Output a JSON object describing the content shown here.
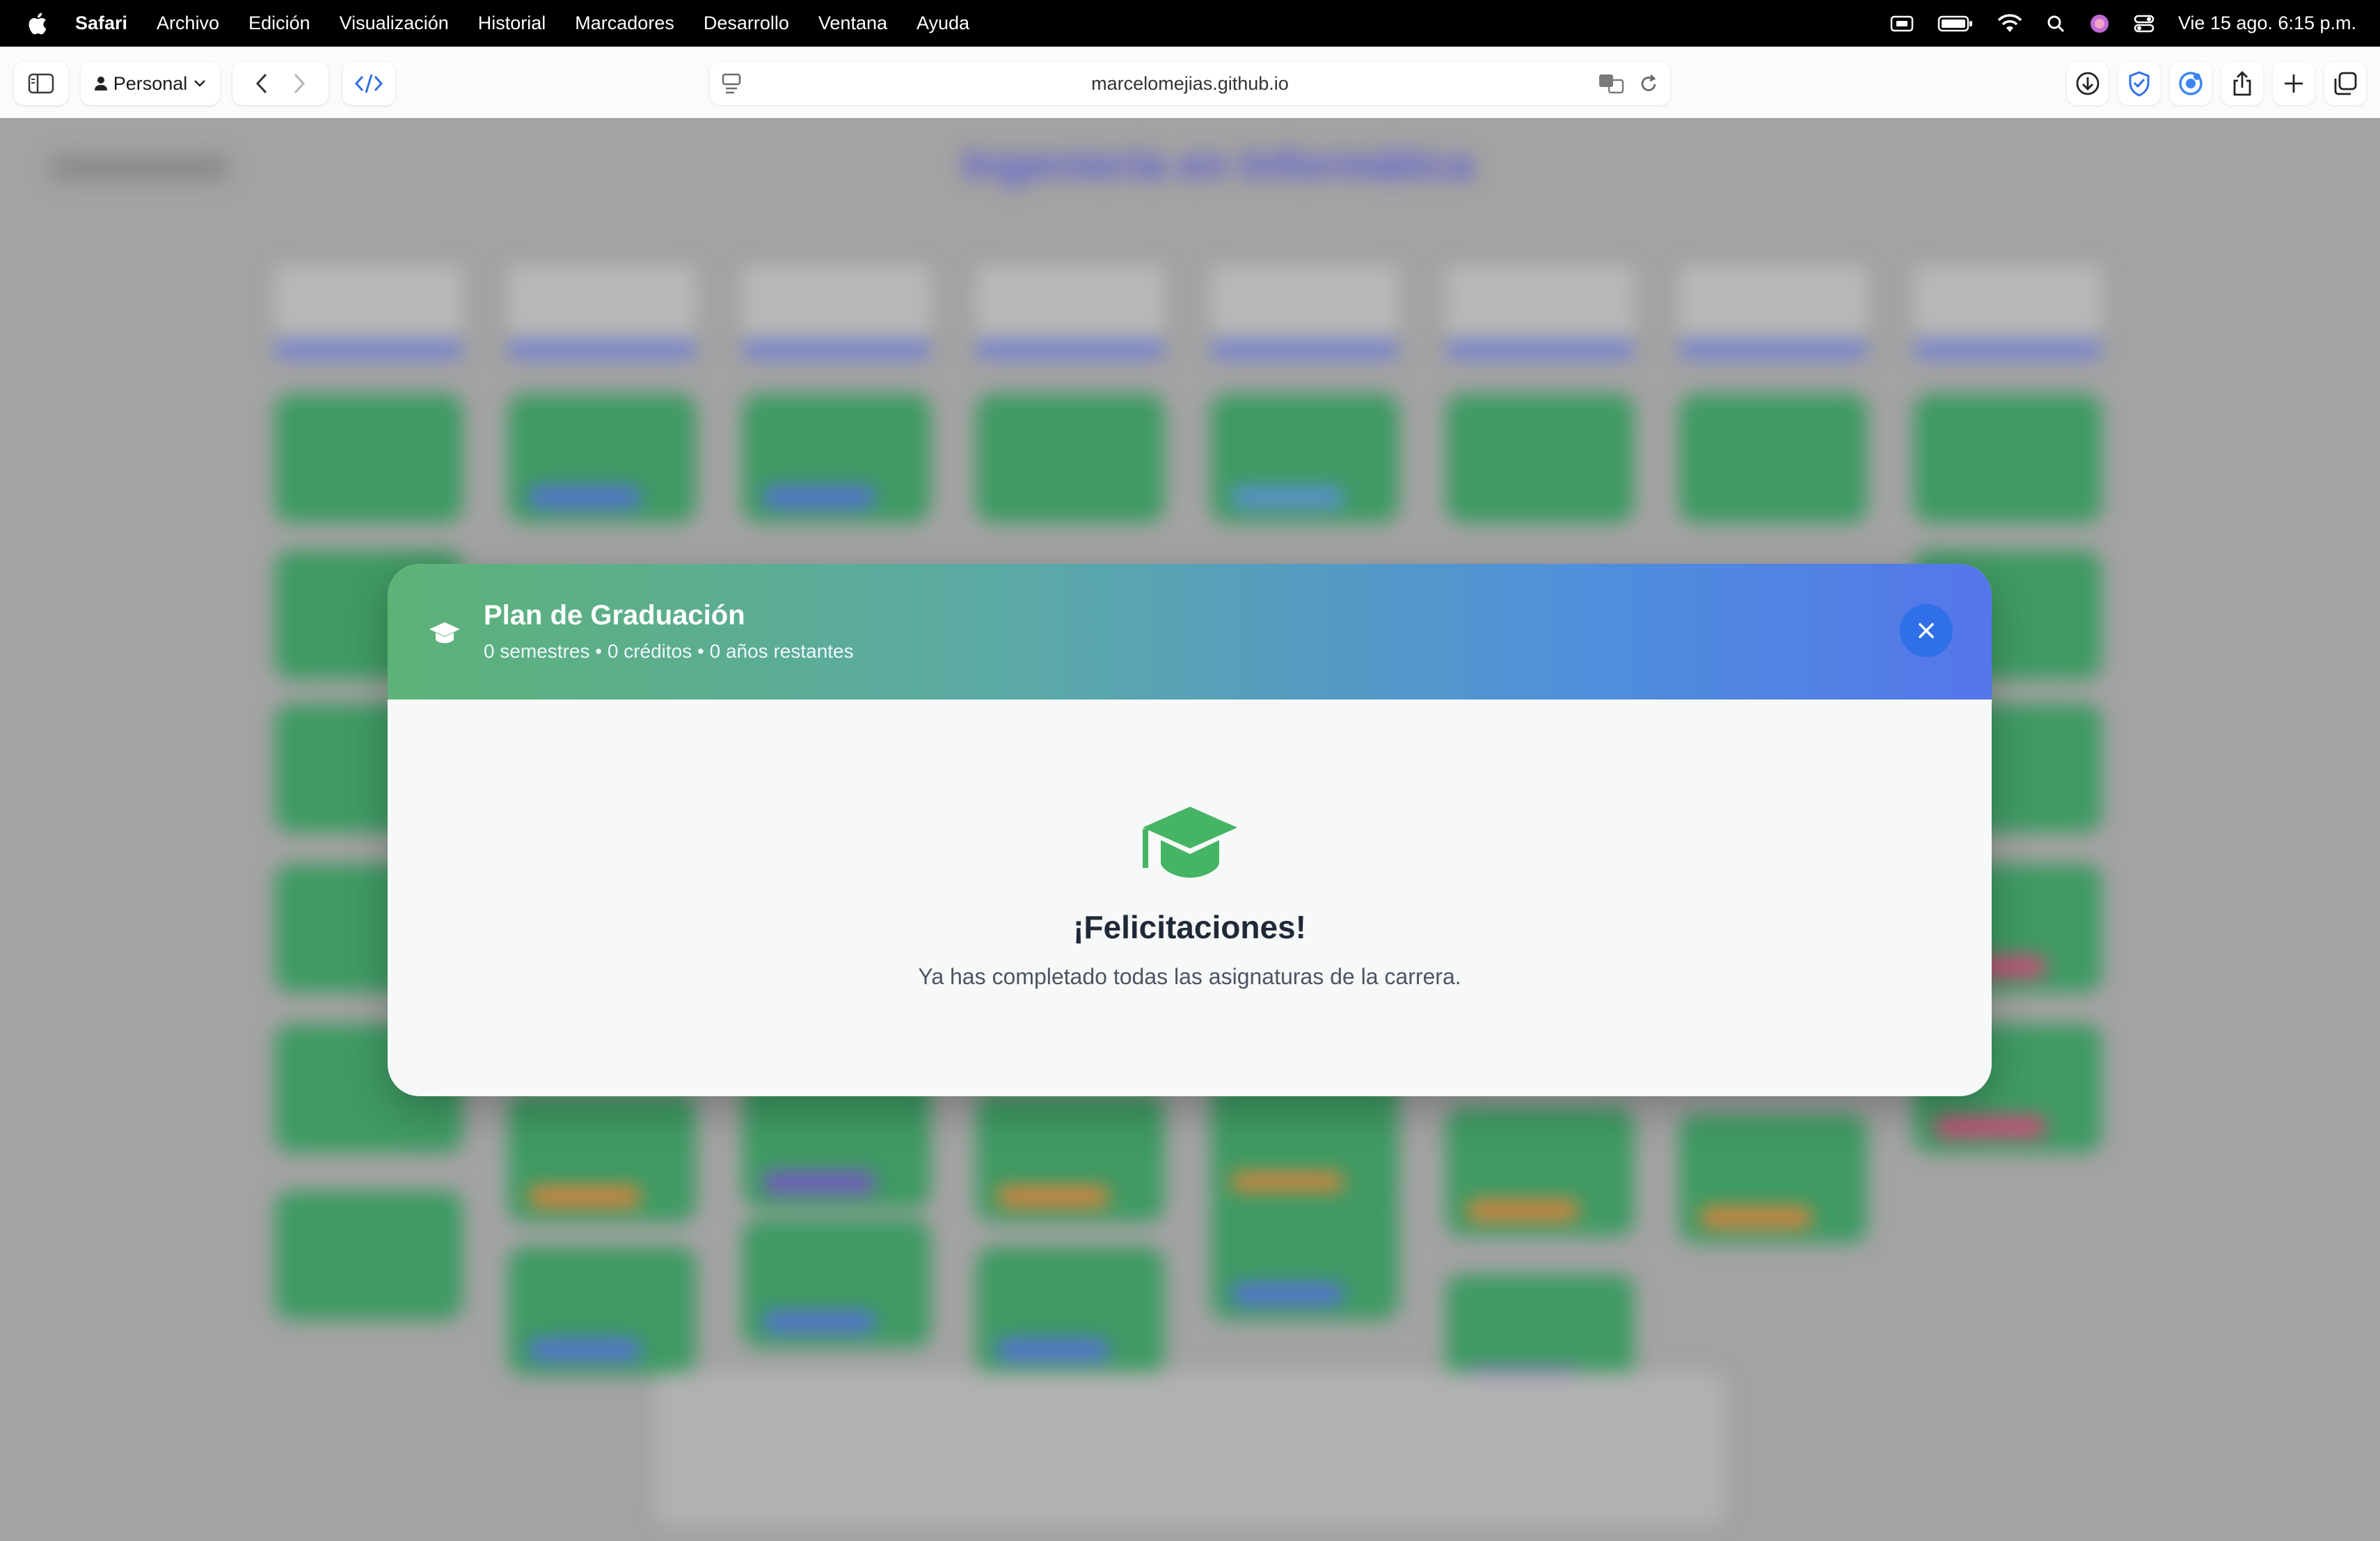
{
  "menubar": {
    "app": "Safari",
    "items": [
      "Archivo",
      "Edición",
      "Visualización",
      "Historial",
      "Marcadores",
      "Desarrollo",
      "Ventana",
      "Ayuda"
    ],
    "datetime": "Vie 15 ago.  6:15 p.m."
  },
  "toolbar": {
    "profile": "Personal",
    "url": "marcelomejias.github.io"
  },
  "page": {
    "title": "Ingeniería en Informática"
  },
  "modal": {
    "title": "Plan de Graduación",
    "subtitle": "0 semestres • 0 créditos • 0 años restantes",
    "congrats_title": "¡Felicitaciones!",
    "congrats_message": "Ya has completado todas las asignaturas de la carrera.",
    "accent_color": "#45b565",
    "close_color": "#2f6fe8"
  }
}
